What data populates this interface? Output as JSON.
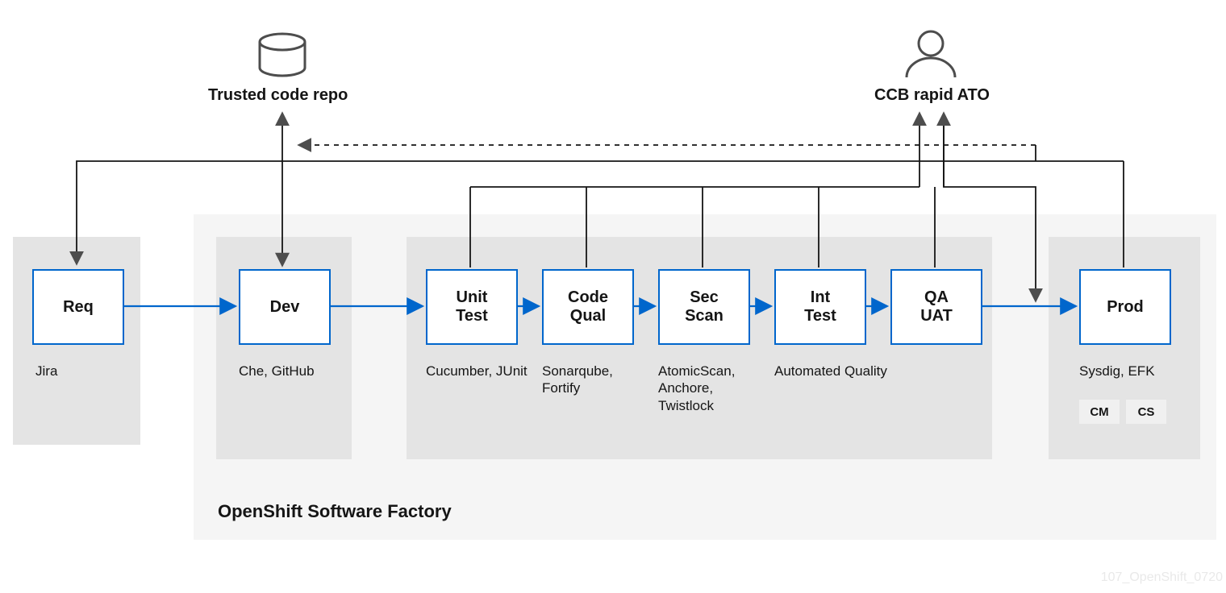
{
  "top": {
    "repo_label": "Trusted code repo",
    "ccb_label": "CCB rapid ATO"
  },
  "factory_label": "OpenShift Software Factory",
  "stages": {
    "req": {
      "title": "Req",
      "tools": "Jira"
    },
    "dev": {
      "title": "Dev",
      "tools": "Che, GitHub"
    },
    "unit": {
      "title1": "Unit",
      "title2": "Test",
      "tools": "Cucumber, JUnit"
    },
    "qual": {
      "title1": "Code",
      "title2": "Qual",
      "tools": "Sonarqube, Fortify"
    },
    "sec": {
      "title1": "Sec",
      "title2": "Scan",
      "tools": "AtomicScan, Anchore, Twistlock"
    },
    "int": {
      "title1": "Int",
      "title2": "Test",
      "tools": "Automated Quality"
    },
    "qa": {
      "title1": "QA",
      "title2": "UAT",
      "tools": ""
    },
    "prod": {
      "title": "Prod",
      "tools": "Sysdig, EFK"
    }
  },
  "tags": {
    "cm": "CM",
    "cs": "CS"
  },
  "watermark": "107_OpenShift_0720",
  "colors": {
    "blue": "#06c",
    "grey": "#4d4d4d"
  }
}
